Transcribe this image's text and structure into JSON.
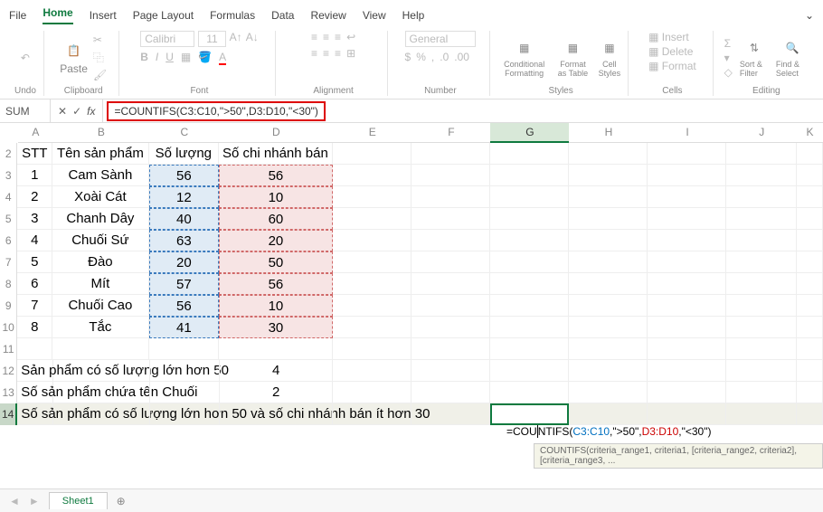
{
  "menu": [
    "File",
    "Home",
    "Insert",
    "Page Layout",
    "Formulas",
    "Data",
    "Review",
    "View",
    "Help"
  ],
  "menu_active": 1,
  "ribbon": {
    "undo": "Undo",
    "clipboard": "Clipboard",
    "paste": "Paste",
    "font": "Font",
    "font_name": "Calibri",
    "font_size": "11",
    "alignment": "Alignment",
    "number": "Number",
    "number_fmt": "General",
    "styles": "Styles",
    "cond": "Conditional Formatting",
    "fmt_table": "Format as Table",
    "cell_styles": "Cell Styles",
    "cells": "Cells",
    "insert": "Insert",
    "delete": "Delete",
    "format": "Format",
    "editing": "Editing",
    "sort": "Sort & Filter",
    "find": "Find & Select"
  },
  "formula": {
    "name": "SUM",
    "text": "=COUNTIFS(C3:C10,\">50\",D3:D10,\"<30\")"
  },
  "cols": [
    "A",
    "B",
    "C",
    "D",
    "E",
    "F",
    "G",
    "H",
    "I",
    "J",
    "K"
  ],
  "headers": [
    "STT",
    "Tên sản phẩm",
    "Số lượng",
    "Số chi nhánh bán"
  ],
  "data": [
    {
      "a": "1",
      "b": "Cam Sành",
      "c": "56",
      "d": "56"
    },
    {
      "a": "2",
      "b": "Xoài Cát",
      "c": "12",
      "d": "10"
    },
    {
      "a": "3",
      "b": "Chanh Dây",
      "c": "40",
      "d": "60"
    },
    {
      "a": "4",
      "b": "Chuối Sứ",
      "c": "63",
      "d": "20"
    },
    {
      "a": "5",
      "b": "Đào",
      "c": "20",
      "d": "50"
    },
    {
      "a": "6",
      "b": "Mít",
      "c": "57",
      "d": "56"
    },
    {
      "a": "7",
      "b": "Chuối Cao",
      "c": "56",
      "d": "10"
    },
    {
      "a": "8",
      "b": "Tắc",
      "c": "41",
      "d": "30"
    }
  ],
  "r12": {
    "label": "Sản phẩm có số lượng lớn hơn 50",
    "val": "4"
  },
  "r13": {
    "label": "Số sản phẩm chứa tên Chuối",
    "val": "2"
  },
  "r14": {
    "label": "Số sản phẩm có số lượng lớn hơn 50 và số chi nhánh bán ít hơn 30"
  },
  "cell_formula": {
    "pre": "=COU",
    "ntifs": "NTIFS(",
    "r1": "C3:C10",
    "c1": ",\">50\",",
    "r2": "D3:D10",
    "c2": ",\"<30\")"
  },
  "tooltip": "COUNTIFS(criteria_range1, criteria1, [criteria_range2, criteria2], [criteria_range3, ...",
  "tabs": {
    "sheet": "Sheet1"
  }
}
